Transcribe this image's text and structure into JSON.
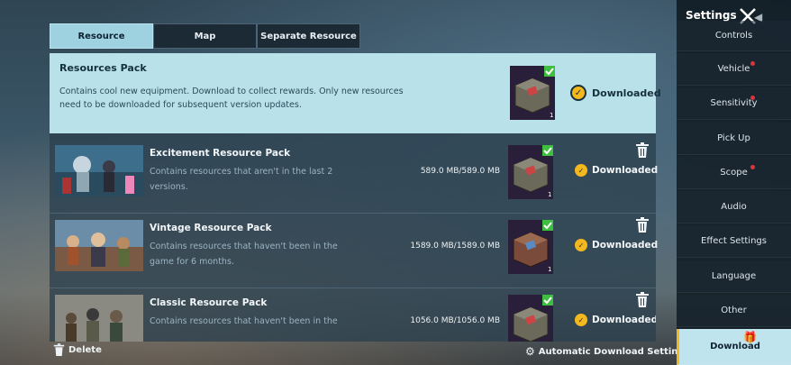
{
  "tabs": [
    {
      "label": "Resource",
      "active": true
    },
    {
      "label": "Map",
      "active": false
    },
    {
      "label": "Separate Resource",
      "active": false
    }
  ],
  "resources_pack": {
    "title": "Resources Pack",
    "description": "Contains cool new equipment. Download to collect rewards. Only new resources need to be downloaded for subsequent version updates.",
    "status": "Downloaded",
    "thumb_count": "1"
  },
  "packs": [
    {
      "title": "Excitement Resource Pack",
      "description": "Contains resources that aren't in the last 2 versions.",
      "size": "589.0 MB/589.0 MB",
      "status": "Downloaded",
      "thumb_count": "1"
    },
    {
      "title": "Vintage Resource Pack",
      "description": "Contains resources that haven't been in the game for 6 months.",
      "size": "1589.0 MB/1589.0 MB",
      "status": "Downloaded",
      "thumb_count": "1"
    },
    {
      "title": "Classic Resource Pack",
      "description": "Contains resources that haven't been in the",
      "size": "1056.0 MB/1056.0 MB",
      "status": "Downloaded",
      "thumb_count": ""
    }
  ],
  "footer": {
    "delete_label": "Delete",
    "auto_download_label": "Automatic Download Settings"
  },
  "sidebar": {
    "title": "Settings",
    "items": [
      {
        "label": "Controls",
        "dot": false,
        "active": false
      },
      {
        "label": "Vehicle",
        "dot": true,
        "active": false
      },
      {
        "label": "Sensitivity",
        "dot": true,
        "active": false
      },
      {
        "label": "Pick Up",
        "dot": false,
        "active": false
      },
      {
        "label": "Scope",
        "dot": true,
        "active": false
      },
      {
        "label": "Audio",
        "dot": false,
        "active": false
      },
      {
        "label": "Effect Settings",
        "dot": false,
        "active": false
      },
      {
        "label": "Language",
        "dot": false,
        "active": false
      },
      {
        "label": "Other",
        "dot": false,
        "active": false
      },
      {
        "label": "Download",
        "dot": false,
        "active": true
      }
    ]
  },
  "colors": {
    "accent_cyan": "#b8e1ea",
    "gold": "#f2b81e",
    "check_green": "#3fbf3f",
    "notify_red": "#e0323a"
  }
}
